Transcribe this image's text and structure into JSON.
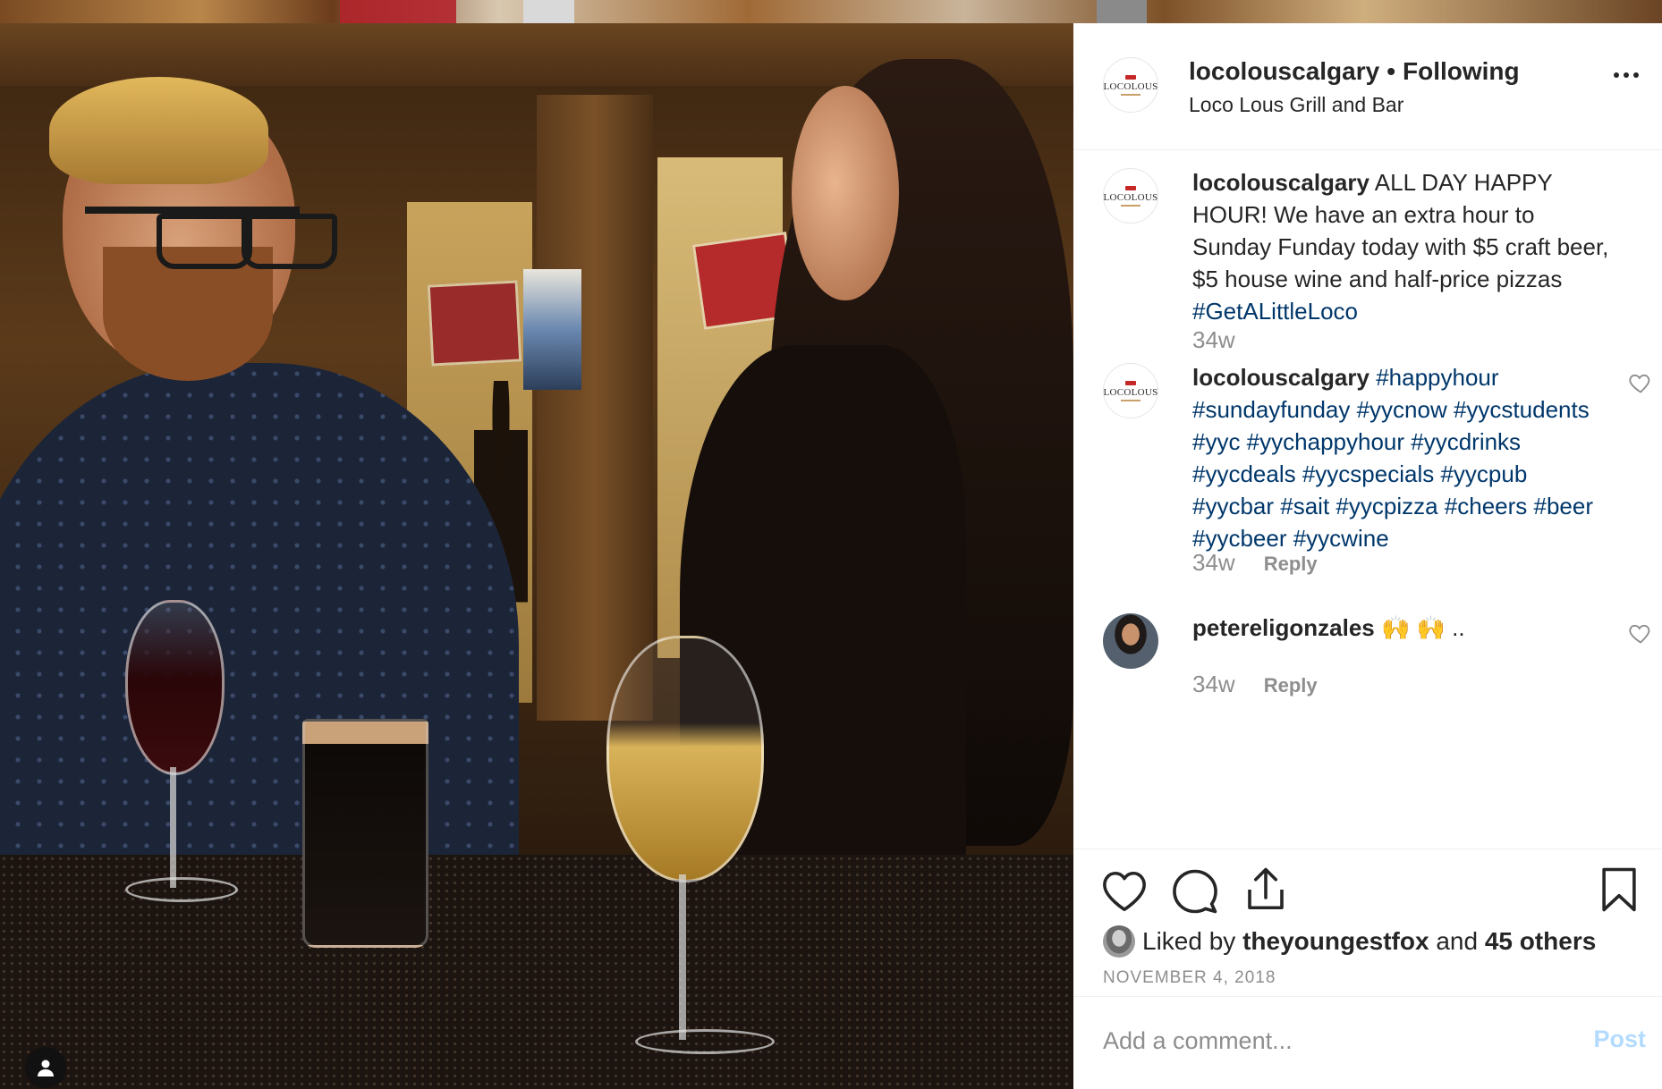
{
  "post": {
    "username": "locolouscalgary",
    "separator": "•",
    "follow_status": "Following",
    "location": "Loco Lous Grill and Bar",
    "avatar_logo_text": "LOCOLOUS"
  },
  "comments": [
    {
      "username": "locolouscalgary",
      "text": "ALL DAY HAPPY HOUR! We have an extra hour to Sunday Funday today with $5 craft beer, $5 house wine and half-price pizzas",
      "hashtag": "#GetALittleLoco",
      "time": "34w"
    },
    {
      "username": "locolouscalgary",
      "hashtags": "#happyhour #sundayfunday #yycnow #yycstudents #yyc #yychappyhour #yycdrinks #yycdeals #yycspecials #yycpub #yycbar #sait #yycpizza #cheers #beer #yycbeer #yycwine",
      "time": "34w",
      "reply_label": "Reply"
    },
    {
      "username": "petereligonzales",
      "text": "🙌 🙌 ..",
      "time": "34w",
      "reply_label": "Reply"
    }
  ],
  "likes": {
    "prefix": "Liked by",
    "first_liker": "theyoungestfox",
    "and": "and",
    "others": "45 others"
  },
  "date": "NOVEMBER 4, 2018",
  "add_comment": {
    "placeholder": "Add a comment...",
    "post_label": "Post"
  },
  "icons": {
    "like": "heart-icon",
    "comment": "comment-bubble-icon",
    "share": "share-icon",
    "save": "bookmark-icon",
    "more": "more-options-icon",
    "profile": "user-icon"
  }
}
